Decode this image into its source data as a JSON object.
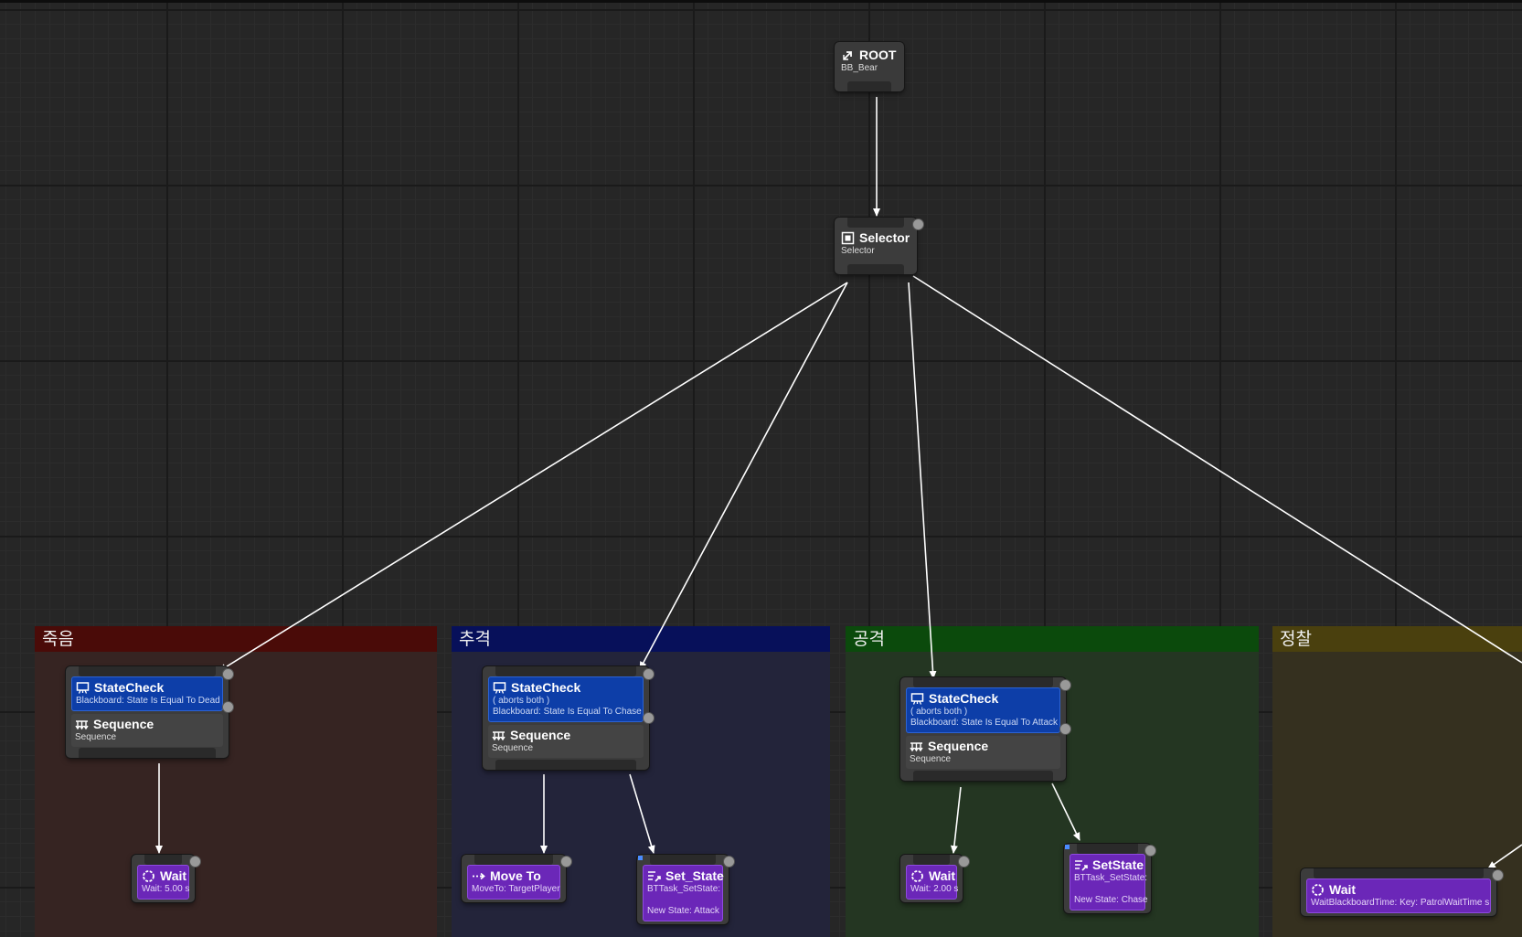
{
  "root": {
    "title": "ROOT",
    "subtitle": "BB_Bear"
  },
  "selector": {
    "title": "Selector",
    "subtitle": "Selector"
  },
  "comments": [
    {
      "label": "죽음",
      "header_color": "#4a0b08",
      "body_color": "#362422"
    },
    {
      "label": "추격",
      "header_color": "#07105a",
      "body_color": "#23243a"
    },
    {
      "label": "공격",
      "header_color": "#0b4a0c",
      "body_color": "#243622"
    },
    {
      "label": "정찰",
      "header_color": "#4a400e",
      "body_color": "#35301f"
    }
  ],
  "branches": {
    "death": {
      "decorator": {
        "title": "StateCheck",
        "lines": [
          "Blackboard: State Is Equal To Dead"
        ]
      },
      "composite": {
        "title": "Sequence",
        "subtitle": "Sequence"
      }
    },
    "chase": {
      "decorator": {
        "title": "StateCheck",
        "lines": [
          "( aborts both )",
          "Blackboard: State Is Equal To Chase"
        ]
      },
      "composite": {
        "title": "Sequence",
        "subtitle": "Sequence"
      }
    },
    "attack": {
      "decorator": {
        "title": "StateCheck",
        "lines": [
          "( aborts both )",
          "Blackboard: State Is Equal To Attack"
        ]
      },
      "composite": {
        "title": "Sequence",
        "subtitle": "Sequence"
      }
    }
  },
  "tasks": {
    "death_wait": {
      "title": "Wait",
      "subtitle": "Wait: 5.00 s"
    },
    "chase_move": {
      "title": "Move To",
      "subtitle": "MoveTo: TargetPlayer"
    },
    "chase_setstate": {
      "title": "Set_State",
      "subtitle": "BTTask_SetState:",
      "detail": "New State: Attack"
    },
    "attack_wait": {
      "title": "Wait",
      "subtitle": "Wait: 2.00 s"
    },
    "attack_setstate": {
      "title": "SetState",
      "subtitle": "BTTask_SetState:",
      "detail": "New State: Chase"
    },
    "patrol_wait": {
      "title": "Wait",
      "subtitle": "WaitBlackboardTime: Key: PatrolWaitTime s"
    }
  },
  "colors": {
    "decorator": "#0d3ea8",
    "task": "#6b27b8",
    "composite": "#444444",
    "wire": "#ffffff",
    "background": "#262626"
  },
  "icons": [
    "root-icon",
    "selector-icon",
    "sequence-icon",
    "statecheck-icon",
    "wait-icon",
    "moveto-icon",
    "setstate-icon"
  ]
}
